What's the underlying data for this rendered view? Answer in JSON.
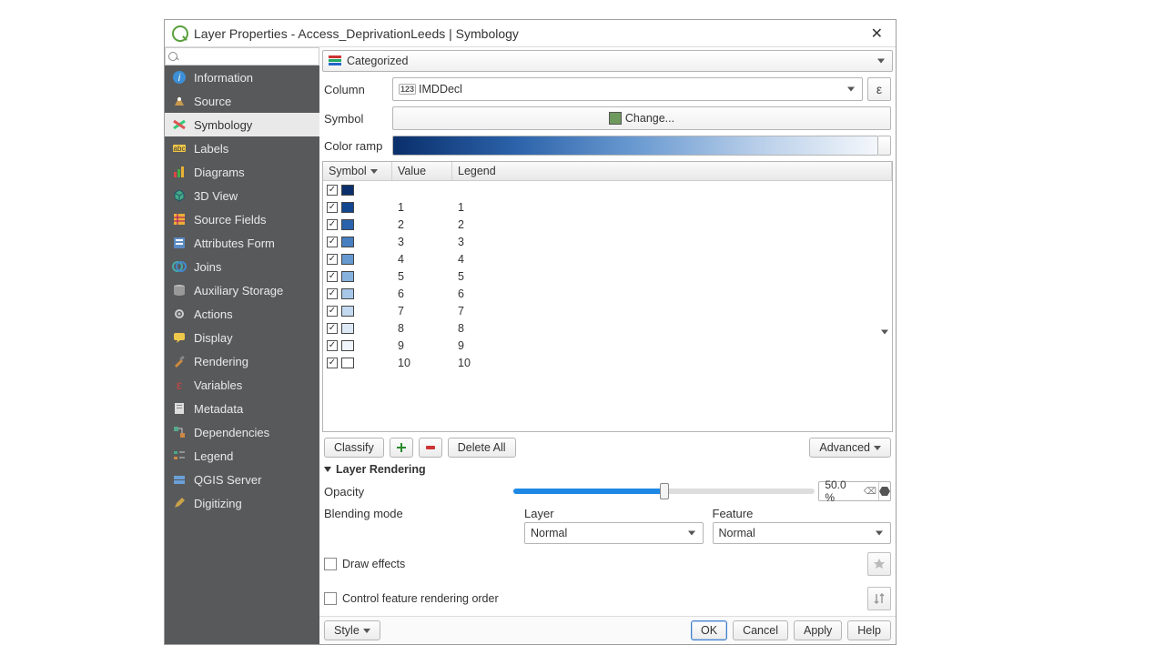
{
  "window": {
    "title": "Layer Properties - Access_DeprivationLeeds | Symbology"
  },
  "sidebar": {
    "search_placeholder": "",
    "items": [
      {
        "label": "Information"
      },
      {
        "label": "Source"
      },
      {
        "label": "Symbology"
      },
      {
        "label": "Labels"
      },
      {
        "label": "Diagrams"
      },
      {
        "label": "3D View"
      },
      {
        "label": "Source Fields"
      },
      {
        "label": "Attributes Form"
      },
      {
        "label": "Joins"
      },
      {
        "label": "Auxiliary Storage"
      },
      {
        "label": "Actions"
      },
      {
        "label": "Display"
      },
      {
        "label": "Rendering"
      },
      {
        "label": "Variables"
      },
      {
        "label": "Metadata"
      },
      {
        "label": "Dependencies"
      },
      {
        "label": "Legend"
      },
      {
        "label": "QGIS Server"
      },
      {
        "label": "Digitizing"
      }
    ]
  },
  "renderer": {
    "type": "Categorized"
  },
  "form": {
    "column_label": "Column",
    "column_value": "IMDDecl",
    "symbol_label": "Symbol",
    "change_label": "Change...",
    "ramp_label": "Color ramp"
  },
  "table": {
    "headers": {
      "symbol": "Symbol",
      "value": "Value",
      "legend": "Legend"
    },
    "rows": [
      {
        "color": "#0a2f6b",
        "value": "",
        "legend": ""
      },
      {
        "color": "#12468f",
        "value": "1",
        "legend": "1"
      },
      {
        "color": "#2a63ac",
        "value": "2",
        "legend": "2"
      },
      {
        "color": "#477fc0",
        "value": "3",
        "legend": "3"
      },
      {
        "color": "#6699d0",
        "value": "4",
        "legend": "4"
      },
      {
        "color": "#87b2de",
        "value": "5",
        "legend": "5"
      },
      {
        "color": "#a6c7e8",
        "value": "6",
        "legend": "6"
      },
      {
        "color": "#c3d9f0",
        "value": "7",
        "legend": "7"
      },
      {
        "color": "#dde9f7",
        "value": "8",
        "legend": "8"
      },
      {
        "color": "#f0f5fb",
        "value": "9",
        "legend": "9"
      },
      {
        "color": "#ffffff",
        "value": "10",
        "legend": "10"
      }
    ]
  },
  "buttons": {
    "classify": "Classify",
    "delete_all": "Delete All",
    "advanced": "Advanced"
  },
  "rendering": {
    "header": "Layer Rendering",
    "opacity_label": "Opacity",
    "opacity_value": "50.0 %",
    "opacity_percent": 50,
    "blend_label": "Blending mode",
    "layer_label": "Layer",
    "feature_label": "Feature",
    "layer_mode": "Normal",
    "feature_mode": "Normal",
    "draw_effects": "Draw effects",
    "control_order": "Control feature rendering order"
  },
  "footer": {
    "style": "Style",
    "ok": "OK",
    "cancel": "Cancel",
    "apply": "Apply",
    "help": "Help"
  },
  "colors": {
    "ramp_stops": [
      "#0a2f6b",
      "#2b62a9",
      "#6a9ad1",
      "#b7cee9",
      "#f4f7fb"
    ]
  }
}
